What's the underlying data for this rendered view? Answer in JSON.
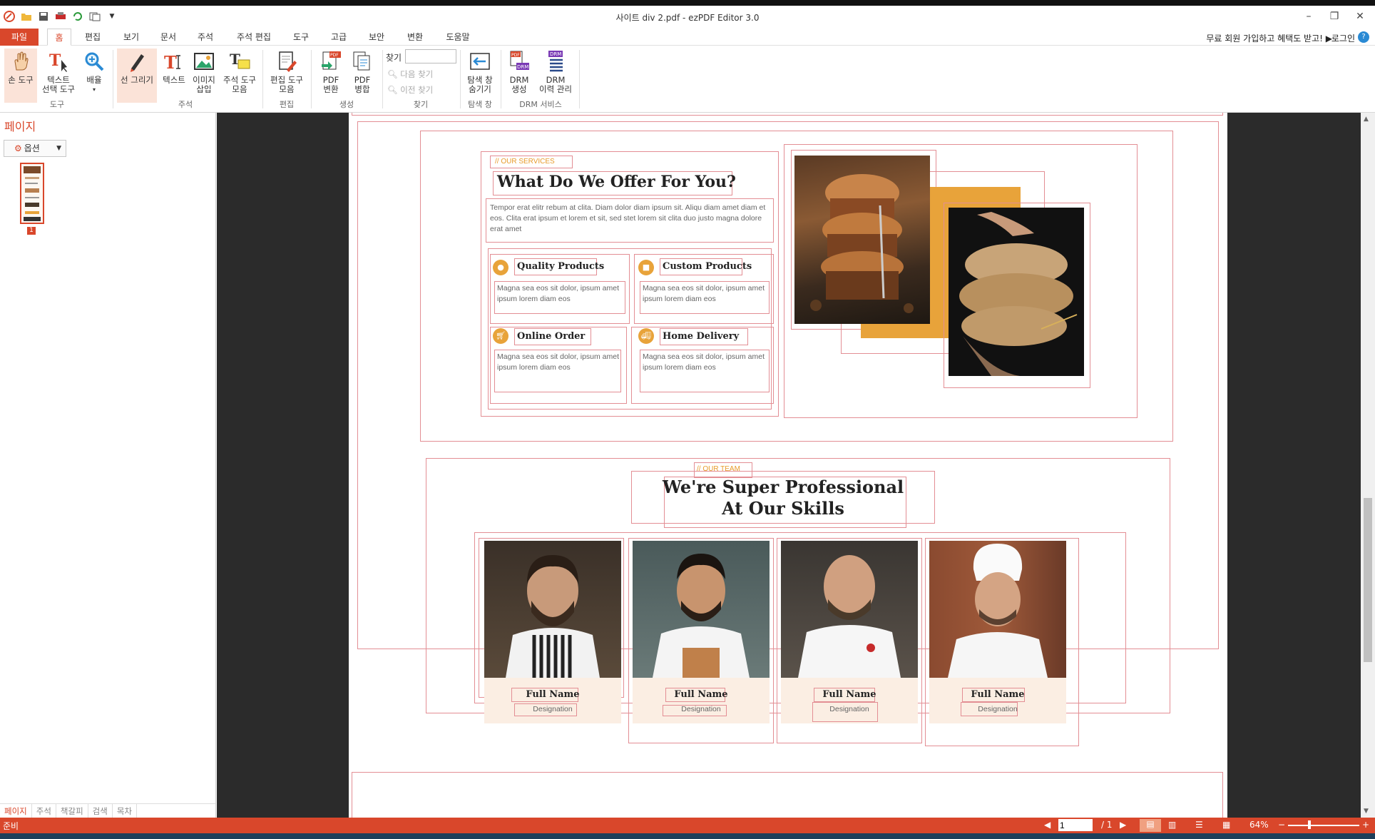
{
  "window": {
    "title": "사이트 div 2.pdf - ezPDF Editor 3.0"
  },
  "menu_tabs": [
    {
      "label": "파일"
    },
    {
      "label": "홈"
    },
    {
      "label": "편집"
    },
    {
      "label": "보기"
    },
    {
      "label": "문서"
    },
    {
      "label": "주석"
    },
    {
      "label": "주석 편집"
    },
    {
      "label": "도구"
    },
    {
      "label": "고급"
    },
    {
      "label": "보안"
    },
    {
      "label": "변환"
    },
    {
      "label": "도움말"
    }
  ],
  "promo": {
    "text": "무료 회원 가입하고 혜택도 받고!",
    "login": "로그인"
  },
  "ribbon": {
    "hand_tool": "손 도구",
    "text_select_line1": "텍스트",
    "text_select_line2": "선택 도구",
    "zoom": "배율",
    "group_tools": "도구",
    "draw_line": "선 그리기",
    "text": "텍스트",
    "image_line1": "이미지",
    "image_line2": "삽입",
    "annot_tools_line1": "주석 도구",
    "annot_tools_line2": "모음",
    "group_annot": "주석",
    "edit_tools_line1": "편집 도구",
    "edit_tools_line2": "모음",
    "group_edit": "편집",
    "pdf_convert_line1": "PDF",
    "pdf_convert_line2": "변환",
    "pdf_merge_line1": "PDF",
    "pdf_merge_line2": "병합",
    "group_create": "생성",
    "find_label": "찾기",
    "find_next": "다음 찾기",
    "find_prev": "이전 찾기",
    "group_find": "찾기",
    "nav_hide_line1": "탐색 창",
    "nav_hide_line2": "숨기기",
    "group_nav": "탐색 창",
    "drm_create_line1": "DRM",
    "drm_create_line2": "생성",
    "drm_history_line1": "DRM",
    "drm_history_line2": "이력 관리",
    "group_drm": "DRM 서비스"
  },
  "left_panel": {
    "title": "페이지",
    "options": "옵션",
    "thumb_number": "1",
    "tabs": [
      "페이지",
      "주석",
      "책갈피",
      "검색",
      "목차"
    ]
  },
  "page_content": {
    "services_tag": "// OUR SERVICES",
    "services_heading": "What Do We Offer For You?",
    "services_desc": "Tempor erat elitr rebum at clita. Diam dolor diam ipsum sit. Aliqu diam amet diam et eos. Clita erat ipsum et lorem et sit, sed stet lorem sit clita duo justo magna dolore erat amet",
    "services": [
      {
        "title": "Quality Products",
        "desc": "Magna sea eos sit dolor, ipsum amet ipsum lorem diam eos"
      },
      {
        "title": "Custom Products",
        "desc": "Magna sea eos sit dolor, ipsum amet ipsum lorem diam eos"
      },
      {
        "title": "Online Order",
        "desc": "Magna sea eos sit dolor, ipsum amet ipsum lorem diam eos"
      },
      {
        "title": "Home Delivery",
        "desc": "Magna sea eos sit dolor, ipsum amet ipsum lorem diam eos"
      }
    ],
    "team_tag": "// OUR TEAM",
    "team_heading_line1": "We're Super Professional",
    "team_heading_line2": "At Our Skills",
    "members": [
      {
        "name": "Full Name",
        "role": "Designation"
      },
      {
        "name": "Full Name",
        "role": "Designation"
      },
      {
        "name": "Full Name",
        "role": "Designation"
      },
      {
        "name": "Full Name",
        "role": "Designation"
      }
    ]
  },
  "statusbar": {
    "status": "준비",
    "page_current": "1",
    "page_total": "/ 1",
    "zoom": "64%"
  },
  "colors": {
    "accent": "#d9472b",
    "bakery_orange": "#e8a33a",
    "outline": "#e38e94"
  }
}
